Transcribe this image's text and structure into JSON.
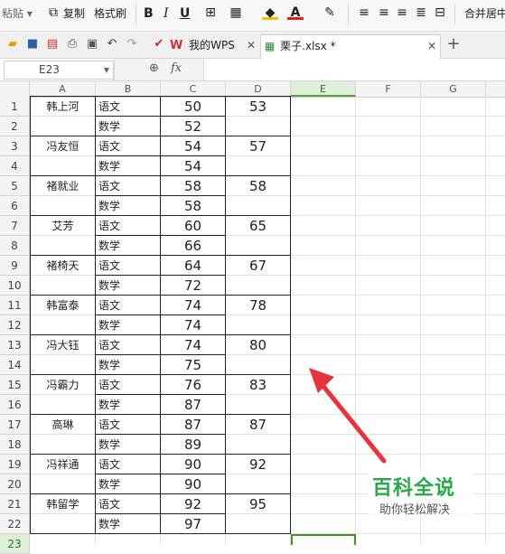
{
  "ribbon": {
    "paste_label": "粘贴",
    "copy_label": "复制",
    "format_painter_label": "格式刷",
    "bold": "B",
    "italic": "I",
    "underline": "U",
    "merge_label": "合并居中"
  },
  "tabs": [
    {
      "label": "我的WPS"
    },
    {
      "label": "栗子.xlsx *"
    }
  ],
  "formula_bar": {
    "cell_ref": "E23",
    "fx_label": "fx",
    "value": ""
  },
  "columns": [
    "A",
    "B",
    "C",
    "D",
    "E",
    "F",
    "G"
  ],
  "rows": [
    "1",
    "2",
    "3",
    "4",
    "5",
    "6",
    "7",
    "8",
    "9",
    "10",
    "11",
    "12",
    "13",
    "14",
    "15",
    "16",
    "17",
    "18",
    "19",
    "20",
    "21",
    "22",
    "23"
  ],
  "records": [
    {
      "name": "韩上河",
      "s1": "语文",
      "v1": "50",
      "s2": "数学",
      "v2": "52",
      "total": "53"
    },
    {
      "name": "冯友恒",
      "s1": "语文",
      "v1": "54",
      "s2": "数学",
      "v2": "54",
      "total": "57"
    },
    {
      "name": "褚就业",
      "s1": "语文",
      "v1": "58",
      "s2": "数学",
      "v2": "58",
      "total": "58"
    },
    {
      "name": "艾芳",
      "s1": "语文",
      "v1": "60",
      "s2": "数学",
      "v2": "66",
      "total": "65"
    },
    {
      "name": "褚椅天",
      "s1": "语文",
      "v1": "64",
      "s2": "数学",
      "v2": "72",
      "total": "67"
    },
    {
      "name": "韩富泰",
      "s1": "语文",
      "v1": "74",
      "s2": "数学",
      "v2": "74",
      "total": "78"
    },
    {
      "name": "冯大钰",
      "s1": "语文",
      "v1": "74",
      "s2": "数学",
      "v2": "75",
      "total": "80"
    },
    {
      "name": "冯霸力",
      "s1": "语文",
      "v1": "76",
      "s2": "数学",
      "v2": "87",
      "total": "83"
    },
    {
      "name": "高琳",
      "s1": "语文",
      "v1": "87",
      "s2": "数学",
      "v2": "89",
      "total": "87"
    },
    {
      "name": "冯祥通",
      "s1": "语文",
      "v1": "90",
      "s2": "数学",
      "v2": "90",
      "total": "92"
    },
    {
      "name": "韩留学",
      "s1": "语文",
      "v1": "92",
      "s2": "数学",
      "v2": "97",
      "total": "95"
    }
  ],
  "watermark": {
    "title": "百科全说",
    "subtitle": "助你轻松解决"
  },
  "annotation_color": "#e8323c",
  "accent_green": "#4a8f2e"
}
